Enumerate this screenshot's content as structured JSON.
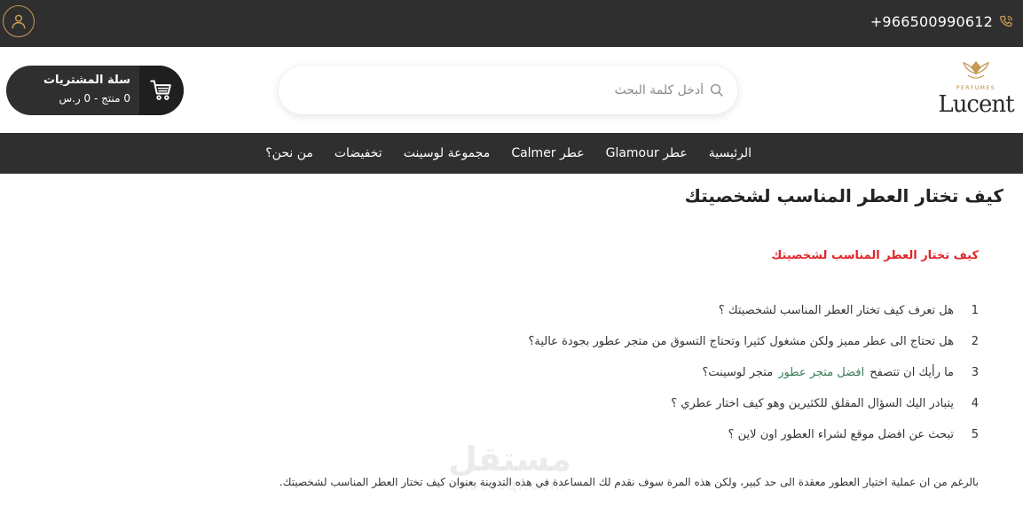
{
  "topbar": {
    "phone": "+966500990612",
    "phone_icon": "phone-icon",
    "account_icon": "user-icon",
    "accent": "#c59a57"
  },
  "header": {
    "logo_text": "Lucent",
    "logo_subtext": "PERFUMES",
    "search": {
      "placeholder": "أدخل كلمة البحث",
      "value": ""
    },
    "cart": {
      "title": "سلة المشتريات",
      "summary": "0 منتج - 0 ر.س",
      "icon": "cart-icon"
    }
  },
  "nav": {
    "items": [
      {
        "label": "الرئيسية"
      },
      {
        "label": "عطر Glamour"
      },
      {
        "label": "عطر Calmer"
      },
      {
        "label": "مجموعة لوسينت"
      },
      {
        "label": "تخفيضات"
      },
      {
        "label": "من نحن؟"
      }
    ]
  },
  "article": {
    "title": "كيف تختار العطر المناسب لشخصيتك",
    "subheading": "كيف تختار العطر المناسب لشخصيتك",
    "subheading_color": "#e0262a",
    "questions": [
      {
        "num": "1",
        "text": "هل تعرف كيف تختار العطر المناسب لشخصيتك ؟"
      },
      {
        "num": "2",
        "text": "هل تحتاج الى عطر مميز ولكن مشغول كثيرا وتحتاج التسوق من متجر عطور بجودة عالية؟"
      },
      {
        "num": "3",
        "text_before": "ما رأيك ان تتصفح",
        "link": "افضل متجر عطور",
        "text_after": "متجر لوسينت؟"
      },
      {
        "num": "4",
        "text": "يتبادر اليك السؤال المقلق للكثيرين وهو كيف اختار عطري ؟"
      },
      {
        "num": "5",
        "text": "تبحث عن افضل موقع لشراء العطور اون لاين ؟"
      }
    ],
    "paragraph": "بالرغم من ان عملية اختيار العطور معقدة الى حد كبير، ولكن هذه المرة سوف نقدم لك المساعدة في هذه التدوينة بعنوان كيف تختار العطر المناسب لشخصيتك."
  },
  "watermark": {
    "text": "مستقل",
    "sub": "mostaql.com"
  }
}
